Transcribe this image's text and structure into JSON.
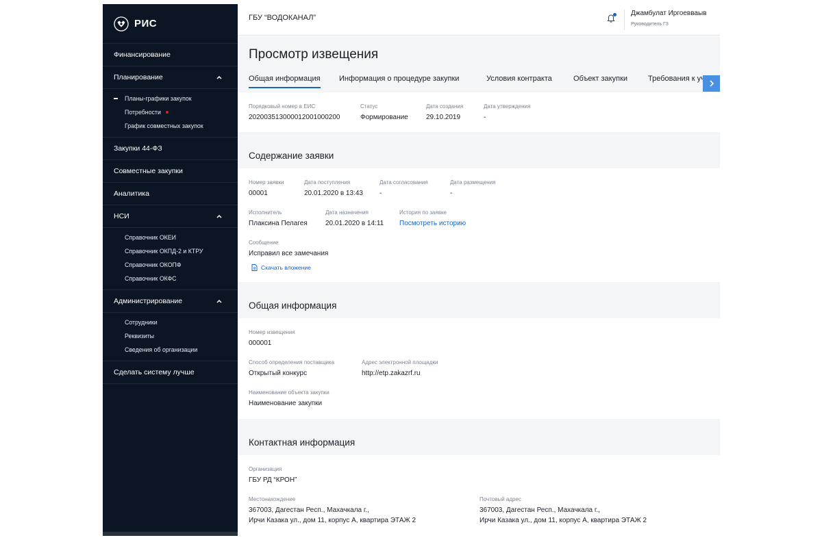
{
  "app": {
    "name": "РИС"
  },
  "sidebar": {
    "items": [
      {
        "label": "Финансирование"
      },
      {
        "label": "Планирование",
        "expanded": true,
        "children": [
          {
            "label": "Планы-графики закупок",
            "active": true
          },
          {
            "label": "Потребности",
            "has_alert_dot": true
          },
          {
            "label": "График совместных закупок"
          }
        ]
      },
      {
        "label": "Закупки 44-ФЗ"
      },
      {
        "label": "Совместные закупки"
      },
      {
        "label": "Аналитика"
      },
      {
        "label": "НСИ",
        "expanded": true,
        "children": [
          {
            "label": "Справочник ОКЕИ"
          },
          {
            "label": "Справочник ОКПД-2 и КТРУ"
          },
          {
            "label": "Справочник ОКОПФ"
          },
          {
            "label": "Справочник ОКФС"
          }
        ]
      },
      {
        "label": "Администрирование",
        "expanded": true,
        "children": [
          {
            "label": "Сотрудники"
          },
          {
            "label": "Реквизиты"
          },
          {
            "label": "Сведения об организации"
          }
        ]
      },
      {
        "label": "Сделать систему лучше"
      }
    ]
  },
  "header": {
    "org": "ГБУ “ВОДОКАНАЛ”",
    "notification_icon": "bell-icon",
    "user": {
      "name": "Джамбулат Иргоевваыв",
      "role": "Руководитель ГЗ"
    }
  },
  "page": {
    "title": "Просмотр извещения",
    "tabs": [
      {
        "label": "Общая информация",
        "active": true
      },
      {
        "label": "Информация о процедуре закупки"
      },
      {
        "label": "Условия контракта"
      },
      {
        "label": "Объект закупки"
      },
      {
        "label": "Требования к участ"
      }
    ]
  },
  "summary": {
    "eis_number": {
      "label": "Порядковый номер в ЕИС",
      "value": "202003513000012001000200"
    },
    "status": {
      "label": "Статус",
      "value": "Формирование"
    },
    "created": {
      "label": "Дата создания",
      "value": "29.10.2019"
    },
    "approved": {
      "label": "Дата утверждения",
      "value": "-"
    }
  },
  "request": {
    "title": "Содержание заявки",
    "number": {
      "label": "Номер заявки",
      "value": "00001"
    },
    "received": {
      "label": "Дата поступления",
      "value": "20.01.2020 в 13:43"
    },
    "agreed": {
      "label": "Дата согласования",
      "value": "-"
    },
    "placed": {
      "label": "Дата размещения",
      "value": "-"
    },
    "executor": {
      "label": "Исполнитель",
      "value": "Плаксина Пелагея"
    },
    "assigned": {
      "label": "Дата назначения",
      "value": "20.01.2020 в 14:11"
    },
    "history": {
      "label": "История по заявке",
      "value": "Посмотреть историю"
    },
    "message": {
      "label": "Сообщение",
      "value": "Исправил все замечания"
    },
    "attachment": "Скачать вложение"
  },
  "general": {
    "title": "Общая информация",
    "notice_number": {
      "label": "Номер извещения",
      "value": "000001"
    },
    "method": {
      "label": "Способ определения поставщика",
      "value": "Открытый конкурс"
    },
    "platform": {
      "label": "Адрес электронной площадки",
      "value": "http://etp.zakazrf.ru"
    },
    "object_name": {
      "label": "Наименование объекта закупки",
      "value": "Наименование закупки"
    }
  },
  "contacts": {
    "title": "Контактная информация",
    "org": {
      "label": "Организация",
      "value": "ГБУ РД “КРОН”"
    },
    "location": {
      "label": "Местонахождение",
      "line1": "367003, Дагестан Респ., Махачкала г.,",
      "line2": "Ирчи Казака ул., дом 11, корпус А, квартира ЭТАЖ 2"
    },
    "postal": {
      "label": "Почтовый адрес",
      "line1": "367003, Дагестан Респ., Махачкала г.,",
      "line2": "Ирчи Казака ул., дом 11, корпус А, квартира ЭТАЖ 2"
    }
  },
  "colors": {
    "sidebar_bg": "#0b1523",
    "accent": "#1565c0",
    "alert": "#e31e24",
    "tab_arrow": "#4a90e2"
  }
}
